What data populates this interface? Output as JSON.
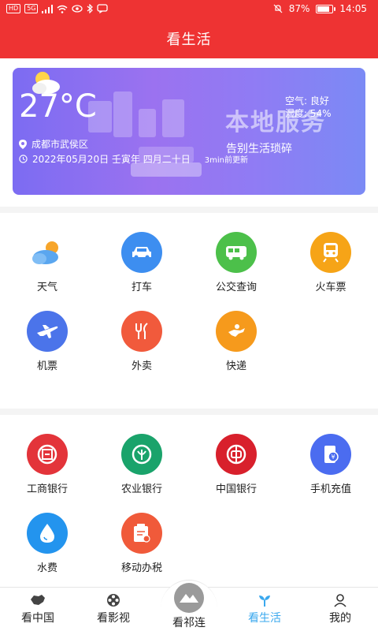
{
  "status_bar": {
    "chip1": "HD",
    "chip2": "5G",
    "battery": "87%",
    "time": "14:05"
  },
  "header": {
    "title": "看生活"
  },
  "banner": {
    "temperature": "27°C",
    "location": "成都市武侯区",
    "date": "2022年05月20日  壬寅年  四月二十日",
    "updated": "3min前更新",
    "air_quality": "空气: 良好",
    "humidity": "湿度: 54%",
    "big_title": "本地服务",
    "subtitle": "告别生活琐碎"
  },
  "life_services": [
    {
      "label": "天气",
      "icon": "weather-icon",
      "color": "#ffffff"
    },
    {
      "label": "打车",
      "icon": "taxi-icon",
      "color": "#3d8ef0"
    },
    {
      "label": "公交查询",
      "icon": "bus-icon",
      "color": "#4cc04a"
    },
    {
      "label": "火车票",
      "icon": "train-icon",
      "color": "#f6a417"
    },
    {
      "label": "机票",
      "icon": "airplane-icon",
      "color": "#4b74ea"
    },
    {
      "label": "外卖",
      "icon": "food-delivery-icon",
      "color": "#f15a3c"
    },
    {
      "label": "快递",
      "icon": "express-icon",
      "color": "#f69a1c"
    }
  ],
  "payment_services": [
    {
      "label": "工商银行",
      "icon": "icbc-icon",
      "color": "#e3343a"
    },
    {
      "label": "农业银行",
      "icon": "abc-bank-icon",
      "color": "#1aa36b"
    },
    {
      "label": "中国银行",
      "icon": "boc-icon",
      "color": "#d8202c"
    },
    {
      "label": "手机充值",
      "icon": "phone-recharge-icon",
      "color": "#4b6cf0"
    },
    {
      "label": "水费",
      "icon": "water-drop-icon",
      "color": "#2394ee"
    },
    {
      "label": "移动办税",
      "icon": "tax-icon",
      "color": "#f05a3a"
    }
  ],
  "bottom_nav": [
    {
      "label": "看中国",
      "icon": "china-map-icon"
    },
    {
      "label": "看影视",
      "icon": "film-reel-icon"
    },
    {
      "label": "看祁连",
      "icon": "mountain-icon"
    },
    {
      "label": "看生活",
      "icon": "sprout-icon"
    },
    {
      "label": "我的",
      "icon": "user-icon"
    }
  ],
  "colors": {
    "header_red": "#ee3333",
    "nav_active": "#3aa8ee"
  }
}
